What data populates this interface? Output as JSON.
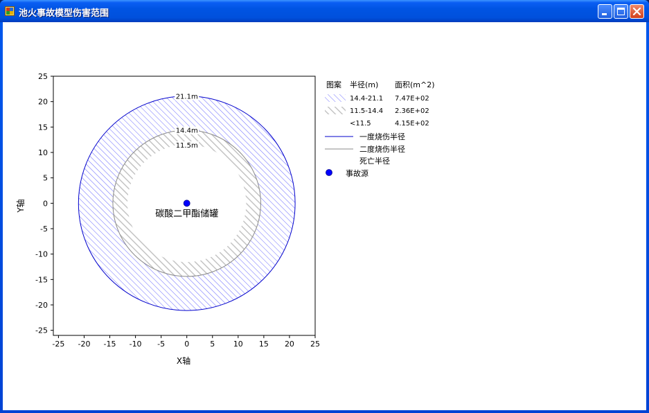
{
  "window": {
    "title": "池火事故模型伤害范围",
    "buttons": {
      "minimize": "minimize-icon",
      "maximize": "maximize-icon",
      "close": "close-icon"
    }
  },
  "chart_data": {
    "type": "scatter",
    "title": "",
    "xlabel": "X轴",
    "ylabel": "Y轴",
    "xlim": [
      -26,
      25
    ],
    "ylim": [
      -26,
      25
    ],
    "x_ticks": [
      -25,
      -20,
      -15,
      -10,
      -5,
      0,
      5,
      10,
      15,
      20,
      25
    ],
    "y_ticks": [
      25,
      20,
      15,
      10,
      5,
      0,
      -5,
      -10,
      -15,
      -20,
      -25
    ],
    "grid": false,
    "source": {
      "name": "事故源",
      "x": 0,
      "y": 0,
      "label": "碳酸二甲酯储罐",
      "color": "#0000ff"
    },
    "circles": [
      {
        "name": "一度烧伤半径",
        "radius": 21.1,
        "label": "21.1m",
        "color": "#0000cc"
      },
      {
        "name": "二度烧伤半径",
        "radius": 14.4,
        "label": "14.4m",
        "color": "#8a8a8a"
      },
      {
        "name": "死亡半径",
        "radius": 11.5,
        "label": "11.5m",
        "color": "#ffffff"
      }
    ],
    "zones": [
      {
        "pattern": "blue-hatch",
        "range": "14.4-21.1",
        "area": "7.47E+02",
        "color": "#6464ff"
      },
      {
        "pattern": "gray-hatch",
        "range": "11.5-14.4",
        "area": "2.36E+02",
        "color": "#c0c0c0"
      },
      {
        "pattern": "none",
        "range": "<11.5",
        "area": "4.15E+02"
      }
    ],
    "legend": {
      "placement": "right",
      "headers": [
        "图案",
        "半径(m)",
        "面积(m^2)"
      ]
    }
  }
}
